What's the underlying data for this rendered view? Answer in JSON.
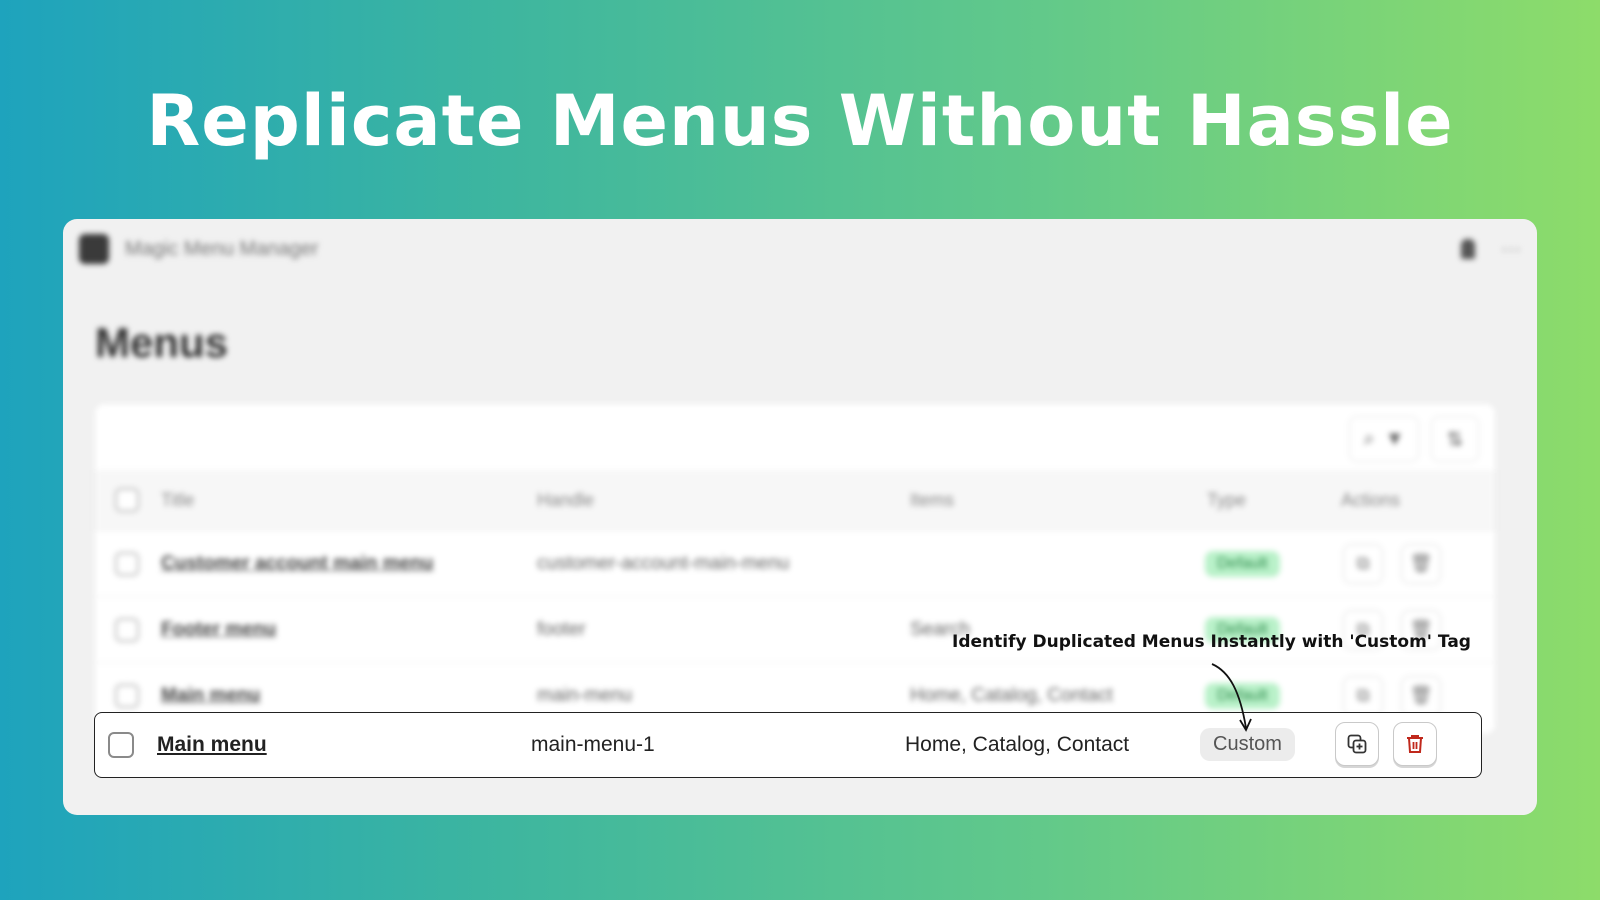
{
  "headline": "Replicate Menus Without Hassle",
  "app": {
    "name": "Magic Menu Manager",
    "page_title": "Menus"
  },
  "table": {
    "headers": {
      "title": "Title",
      "handle": "Handle",
      "items": "Items",
      "type": "Type",
      "actions": "Actions"
    },
    "rows": [
      {
        "title": "Customer account main menu",
        "handle": "customer-account-main-menu",
        "items": "",
        "type": "Default"
      },
      {
        "title": "Footer menu",
        "handle": "footer",
        "items": "Search",
        "type": "Default"
      },
      {
        "title": "Main menu",
        "handle": "main-menu",
        "items": "Home, Catalog, Contact",
        "type": "Default"
      }
    ],
    "highlighted_row": {
      "title": "Main menu",
      "handle": "main-menu-1",
      "items": "Home, Catalog, Contact",
      "type": "Custom"
    }
  },
  "callout": "Identify Duplicated Menus Instantly with 'Custom' Tag",
  "colors": {
    "gradient_start": "#1ea3bd",
    "gradient_end": "#8ddc6a",
    "delete_icon": "#c0281c",
    "default_tag_bg": "#b9f1c9"
  },
  "icons": [
    "search-icon",
    "filter-icon",
    "sort-icon",
    "pin-icon",
    "more-icon",
    "duplicate-icon",
    "trash-icon"
  ]
}
